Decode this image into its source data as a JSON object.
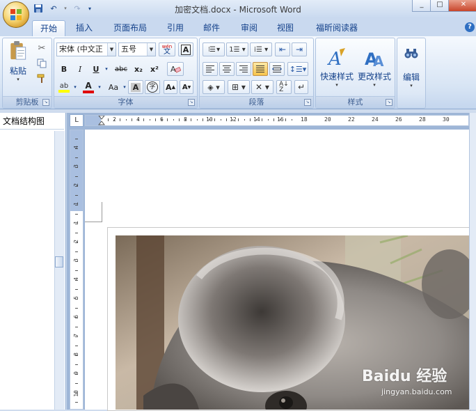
{
  "window": {
    "title": "加密文档.docx - Microsoft Word",
    "minimize": "_",
    "maximize": "□",
    "close": "✕"
  },
  "tabs": [
    {
      "label": "开始",
      "active": true
    },
    {
      "label": "插入"
    },
    {
      "label": "页面布局"
    },
    {
      "label": "引用"
    },
    {
      "label": "邮件"
    },
    {
      "label": "审阅"
    },
    {
      "label": "视图"
    },
    {
      "label": "福昕阅读器"
    }
  ],
  "clipboard": {
    "paste_label": "粘贴",
    "group_label": "剪贴板"
  },
  "font": {
    "font_name": "宋体 (中文正",
    "font_size": "五号",
    "wen_label": "wén",
    "wen_char": "文",
    "bold": "B",
    "italic": "I",
    "underline": "U",
    "strike": "abc",
    "subscript": "x₂",
    "superscript": "x²",
    "change_case": "Aa",
    "grow": "A",
    "shrink": "A",
    "group_label": "字体"
  },
  "paragraph": {
    "group_label": "段落"
  },
  "styles": {
    "quick_styles": "快速样式",
    "change_styles": "更改样式",
    "group_label": "样式"
  },
  "editing": {
    "label": "编辑"
  },
  "nav": {
    "title": "文档结构图"
  },
  "ruler": {
    "tab_selector": "L",
    "h_numbers": [
      "2",
      "4",
      "6",
      "8",
      "10",
      "12",
      "14",
      "16",
      "18",
      "20",
      "22",
      "24",
      "26",
      "28",
      "30"
    ],
    "v_numbers": [
      "4",
      "3",
      "2",
      "1",
      "1",
      "2",
      "3",
      "4",
      "5",
      "6",
      "7",
      "8",
      "9",
      "10"
    ]
  },
  "watermark": {
    "main": "Baidu 经验",
    "sub": "jingyan.baidu.com"
  },
  "colors": {
    "accent": "#15428b",
    "ribbon": "#dde8f6",
    "highlight": "#ffff00",
    "font_color": "#e00000"
  }
}
